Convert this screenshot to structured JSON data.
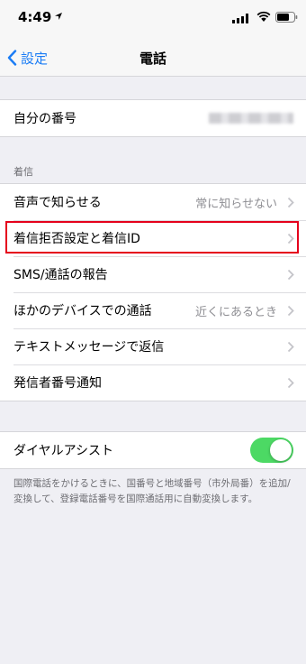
{
  "status": {
    "time": "4:49"
  },
  "nav": {
    "back_label": "設定",
    "title": "電話"
  },
  "my_number": {
    "label": "自分の番号"
  },
  "incoming": {
    "header": "着信",
    "rows": [
      {
        "label": "音声で知らせる",
        "value": "常に知らせない"
      },
      {
        "label": "着信拒否設定と着信ID",
        "value": ""
      },
      {
        "label": "SMS/通話の報告",
        "value": ""
      },
      {
        "label": "ほかのデバイスでの通話",
        "value": "近くにあるとき"
      },
      {
        "label": "テキストメッセージで返信",
        "value": ""
      },
      {
        "label": "発信者番号通知",
        "value": ""
      }
    ]
  },
  "dial_assist": {
    "label": "ダイヤルアシスト",
    "enabled": true,
    "footer": "国際電話をかけるときに、国番号と地域番号（市外局番）を追加/変換して、登録電話番号を国際通話用に自動変換します。"
  },
  "colors": {
    "accent": "#1a7cf5",
    "toggle_on": "#4cd964",
    "highlight": "#e5001c"
  }
}
